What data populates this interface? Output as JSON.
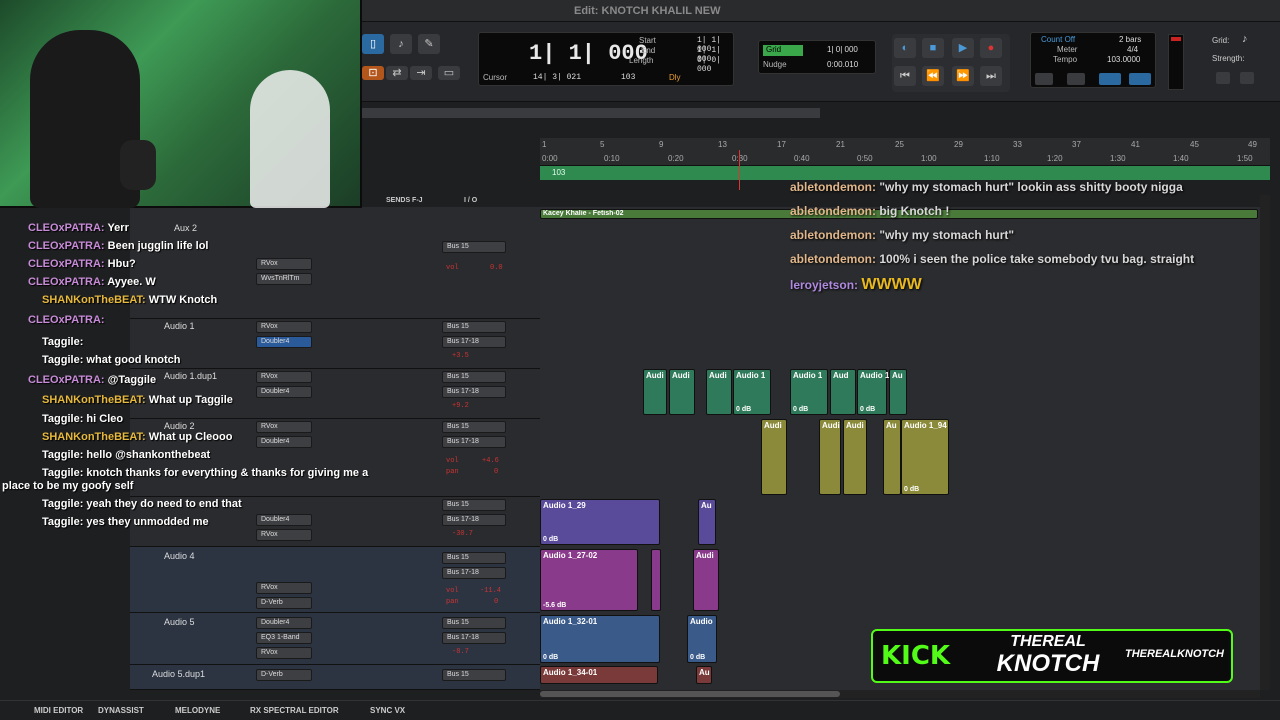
{
  "window": {
    "title": "Edit: KNOTCH KHALIL NEW"
  },
  "counter": {
    "main": "1| 1| 000",
    "start_label": "Start",
    "end_label": "End",
    "length_label": "Length",
    "start": "1| 1| 000",
    "end": "1| 1| 000",
    "length": "0| 0| 000",
    "cursor_label": "Cursor",
    "cursor": "14| 3| 021",
    "tempo": "103",
    "dly": "Dly"
  },
  "grid": {
    "grid_label": "Grid",
    "grid_value": "1| 0| 000",
    "nudge_label": "Nudge",
    "nudge_value": "0:00.010"
  },
  "meter": {
    "count_off": "Count Off",
    "bars": "2 bars",
    "meter_label": "Meter",
    "meter_value": "4/4",
    "tempo_label": "Tempo",
    "tempo_value": "103.0000"
  },
  "gridstrength": {
    "grid": "Grid:",
    "strength": "Strength:"
  },
  "ruler": {
    "bars": [
      "1",
      "5",
      "9",
      "13",
      "17",
      "21",
      "25",
      "29",
      "33",
      "37",
      "41",
      "45",
      "49"
    ],
    "times": [
      "0:00",
      "0:10",
      "0:20",
      "0:30",
      "0:40",
      "0:50",
      "1:00",
      "1:10",
      "1:20",
      "1:30",
      "1:40",
      "1:50"
    ],
    "tempo_marker": "103"
  },
  "columns": {
    "sends": "SENDS F-J",
    "io": "I / O"
  },
  "tracks": [
    {
      "name": "Aux 2",
      "insert1": "RVox",
      "insert2": "WvsTnRlTm",
      "bus": "Bus 15",
      "vol": "vol",
      "volval": "0.0"
    },
    {
      "name": "Audio 1",
      "insert1": "RVox",
      "insert2": "Doubler4",
      "bus": "Bus 15",
      "bus2": "Bus 17-18",
      "volval": "+3.5"
    },
    {
      "name": "Audio 1.dup1",
      "insert1": "RVox",
      "insert2": "Doubler4",
      "bus": "Bus 15",
      "bus2": "Bus 17-18",
      "volval": "+9.2"
    },
    {
      "name": "Audio 2",
      "insert1": "RVox",
      "insert2": "Doubler4",
      "bus": "Bus 15",
      "bus2": "Bus 17-18",
      "vol": "vol",
      "volval": "+4.6",
      "pan": "pan",
      "panval": "0"
    },
    {
      "name": "Audio 3",
      "insert1": "Doubler4",
      "insert2": "RVox",
      "bus": "Bus 15",
      "bus2": "Bus 17-18",
      "volval": "-30.7",
      "panval": "0"
    },
    {
      "name": "Audio 4",
      "insert1": "RVox",
      "insert2": "D-Verb",
      "bus": "Bus 15",
      "bus2": "Bus 17-18",
      "vol": "vol",
      "volval": "-11.4",
      "pan": "pan",
      "panval": "0"
    },
    {
      "name": "Audio 5",
      "insert1": "Doubler4",
      "insert2": "EQ3 1-Band",
      "insert3": "RVox",
      "bus": "Bus 15",
      "bus2": "Bus 17-18",
      "volval": "-8.7",
      "panval": "0"
    },
    {
      "name": "Audio 5.dup1",
      "insert1": "D-Verb",
      "bus": "Bus 15"
    }
  ],
  "clips": {
    "top_clip": "Kacey Khalie - Fetish-02",
    "audio_1_29": "Audio 1_29",
    "audio_1_27": "Audio 1_27-02",
    "audio_1_32": "Audio 1_32-01",
    "audio_1_34": "Audio 1_34-01",
    "audio_1_94": "Audio 1_94",
    "audio_1": "Audio 1",
    "audio_short": "Audi",
    "aud": "Aud",
    "au": "Au",
    "audio": "Audio",
    "db0": "0 dB",
    "db56": "-5.6 dB"
  },
  "bottom": {
    "items": [
      "MIDI EDITOR",
      "DYNASSIST",
      "MELODYNE",
      "RX SPECTRAL EDITOR",
      "SYNC VX"
    ]
  },
  "chat_left": [
    {
      "user": "CLEOxPATRA:",
      "msg": "Yerr"
    },
    {
      "user": "CLEOxPATRA:",
      "msg": "Been jugglin life lol"
    },
    {
      "user": "CLEOxPATRA:",
      "msg": "Hbu?"
    },
    {
      "user": "CLEOxPATRA:",
      "msg": "Ayyee. W"
    },
    {
      "user": "SHANKonTheBEAT:",
      "msg": "WTW Knotch"
    },
    {
      "user": "CLEOxPATRA:",
      "msg": ""
    },
    {
      "user": "Taggile:",
      "msg": ""
    },
    {
      "user": "Taggile:",
      "msg": "what good knotch"
    },
    {
      "user": "CLEOxPATRA:",
      "msg": "@Taggile"
    },
    {
      "user": "SHANKonTheBEAT:",
      "msg": "What up Taggile"
    },
    {
      "user": "Taggile:",
      "msg": "hi Cleo"
    },
    {
      "user": "SHANKonTheBEAT:",
      "msg": "What up Cleooo"
    },
    {
      "user": "Taggile:",
      "msg": "hello @shankonthebeat"
    },
    {
      "user": "Taggile:",
      "msg": "knotch thanks for everything & thanks for giving me a"
    },
    {
      "user": "",
      "msg": "place to be my goofy self"
    },
    {
      "user": "Taggile:",
      "msg": "yeah they do need to end that"
    },
    {
      "user": "Taggile:",
      "msg": "yes they unmodded me"
    }
  ],
  "chat_right": [
    {
      "user": "abletondemon:",
      "msg": "\"why my stomach hurt\" lookin ass shitty booty nigga"
    },
    {
      "user": "abletondemon:",
      "msg": "big Knotch !"
    },
    {
      "user": "abletondemon:",
      "msg": "\"why my stomach hurt\""
    },
    {
      "user": "abletondemon:",
      "msg": "100% i seen the police take somebody tvu bag. straight"
    },
    {
      "user": "leroyjetson:",
      "msg": "WWWW"
    }
  ],
  "kick": {
    "brand": "KICK",
    "line1": "THEREAL",
    "line2": "KNOTCH",
    "handle": "THEREALKNOTCH"
  },
  "colors": {
    "kick_green": "#53fc18",
    "clip_green": "#3a7a5a",
    "clip_yellow": "#8a8a3a",
    "clip_purple": "#5a4a9a",
    "clip_magenta": "#8a3a8a",
    "clip_blue": "#3a5a8a"
  }
}
